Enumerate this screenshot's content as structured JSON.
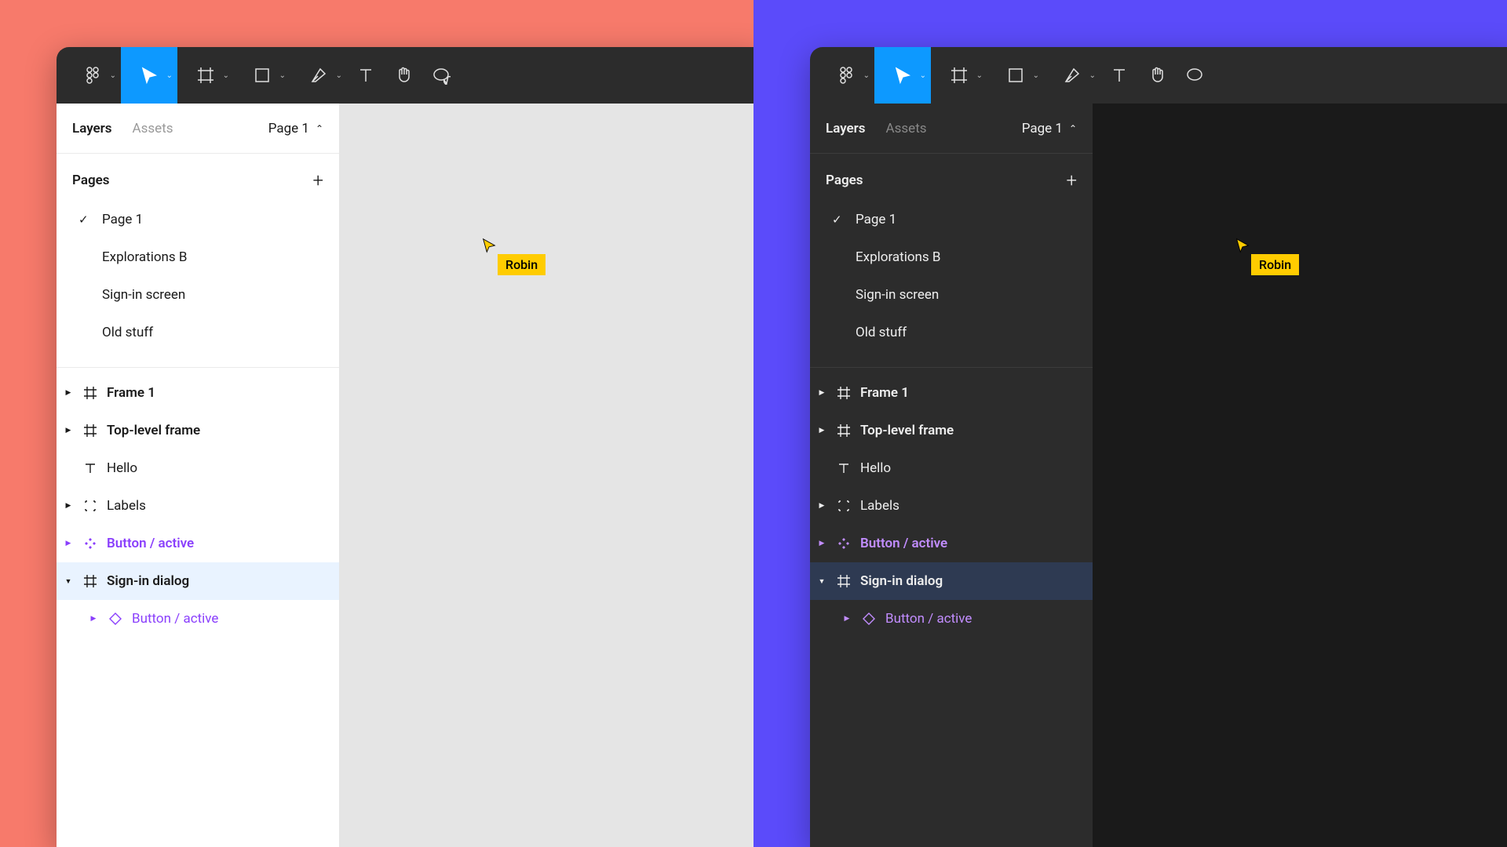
{
  "themes": {
    "left_bg": "#F77A6B",
    "right_bg": "#5B4BFA",
    "accent": "#0D99FF",
    "component_purple": "#8A3FFC",
    "cursor_tag_bg": "#FFCC00"
  },
  "toolbar": {
    "tools": [
      "figma-menu",
      "move",
      "frame",
      "rectangle",
      "pen",
      "text",
      "hand",
      "comment"
    ],
    "active": "move"
  },
  "panel": {
    "tabs": {
      "layers": "Layers",
      "assets": "Assets"
    },
    "page_selector": "Page 1",
    "pages_header": "Pages",
    "pages": [
      {
        "name": "Page 1",
        "selected": true
      },
      {
        "name": "Explorations B",
        "selected": false
      },
      {
        "name": "Sign-in screen",
        "selected": false
      },
      {
        "name": "Old stuff",
        "selected": false
      }
    ],
    "layers": [
      {
        "name": "Frame 1",
        "icon": "frame",
        "bold": true,
        "expand": "right",
        "nested": false,
        "purple": false,
        "selected": false
      },
      {
        "name": "Top-level frame",
        "icon": "frame",
        "bold": true,
        "expand": "right",
        "nested": false,
        "purple": false,
        "selected": false
      },
      {
        "name": "Hello",
        "icon": "text",
        "bold": false,
        "expand": null,
        "nested": false,
        "purple": false,
        "selected": false
      },
      {
        "name": "Labels",
        "icon": "group",
        "bold": false,
        "expand": "right",
        "nested": false,
        "purple": false,
        "selected": false
      },
      {
        "name": "Button / active",
        "icon": "component",
        "bold": true,
        "expand": "right",
        "nested": false,
        "purple": true,
        "selected": false
      },
      {
        "name": "Sign-in dialog",
        "icon": "frame",
        "bold": true,
        "expand": "down",
        "nested": false,
        "purple": false,
        "selected": true
      },
      {
        "name": "Button / active",
        "icon": "instance",
        "bold": false,
        "expand": "right",
        "nested": true,
        "purple": true,
        "selected": false
      }
    ]
  },
  "collaborator": {
    "name": "Robin"
  }
}
